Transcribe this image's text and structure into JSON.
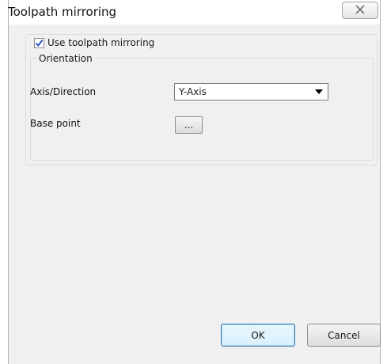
{
  "window": {
    "title": "Toolpath mirroring"
  },
  "icons": {
    "close": "close-icon",
    "check": "check-icon",
    "dropdown": "chevron-down-icon"
  },
  "mirroring": {
    "checkbox_label": "Use toolpath mirroring",
    "checked": true
  },
  "orientation": {
    "group_label": "Orientation",
    "axis_label": "Axis/Direction",
    "axis_value": "Y-Axis",
    "base_point_label": "Base point",
    "base_point_button": "..."
  },
  "footer": {
    "ok_label": "OK",
    "cancel_label": "Cancel"
  },
  "colors": {
    "accent": "#3c7fb1",
    "client_bg": "#f0f0f0"
  }
}
